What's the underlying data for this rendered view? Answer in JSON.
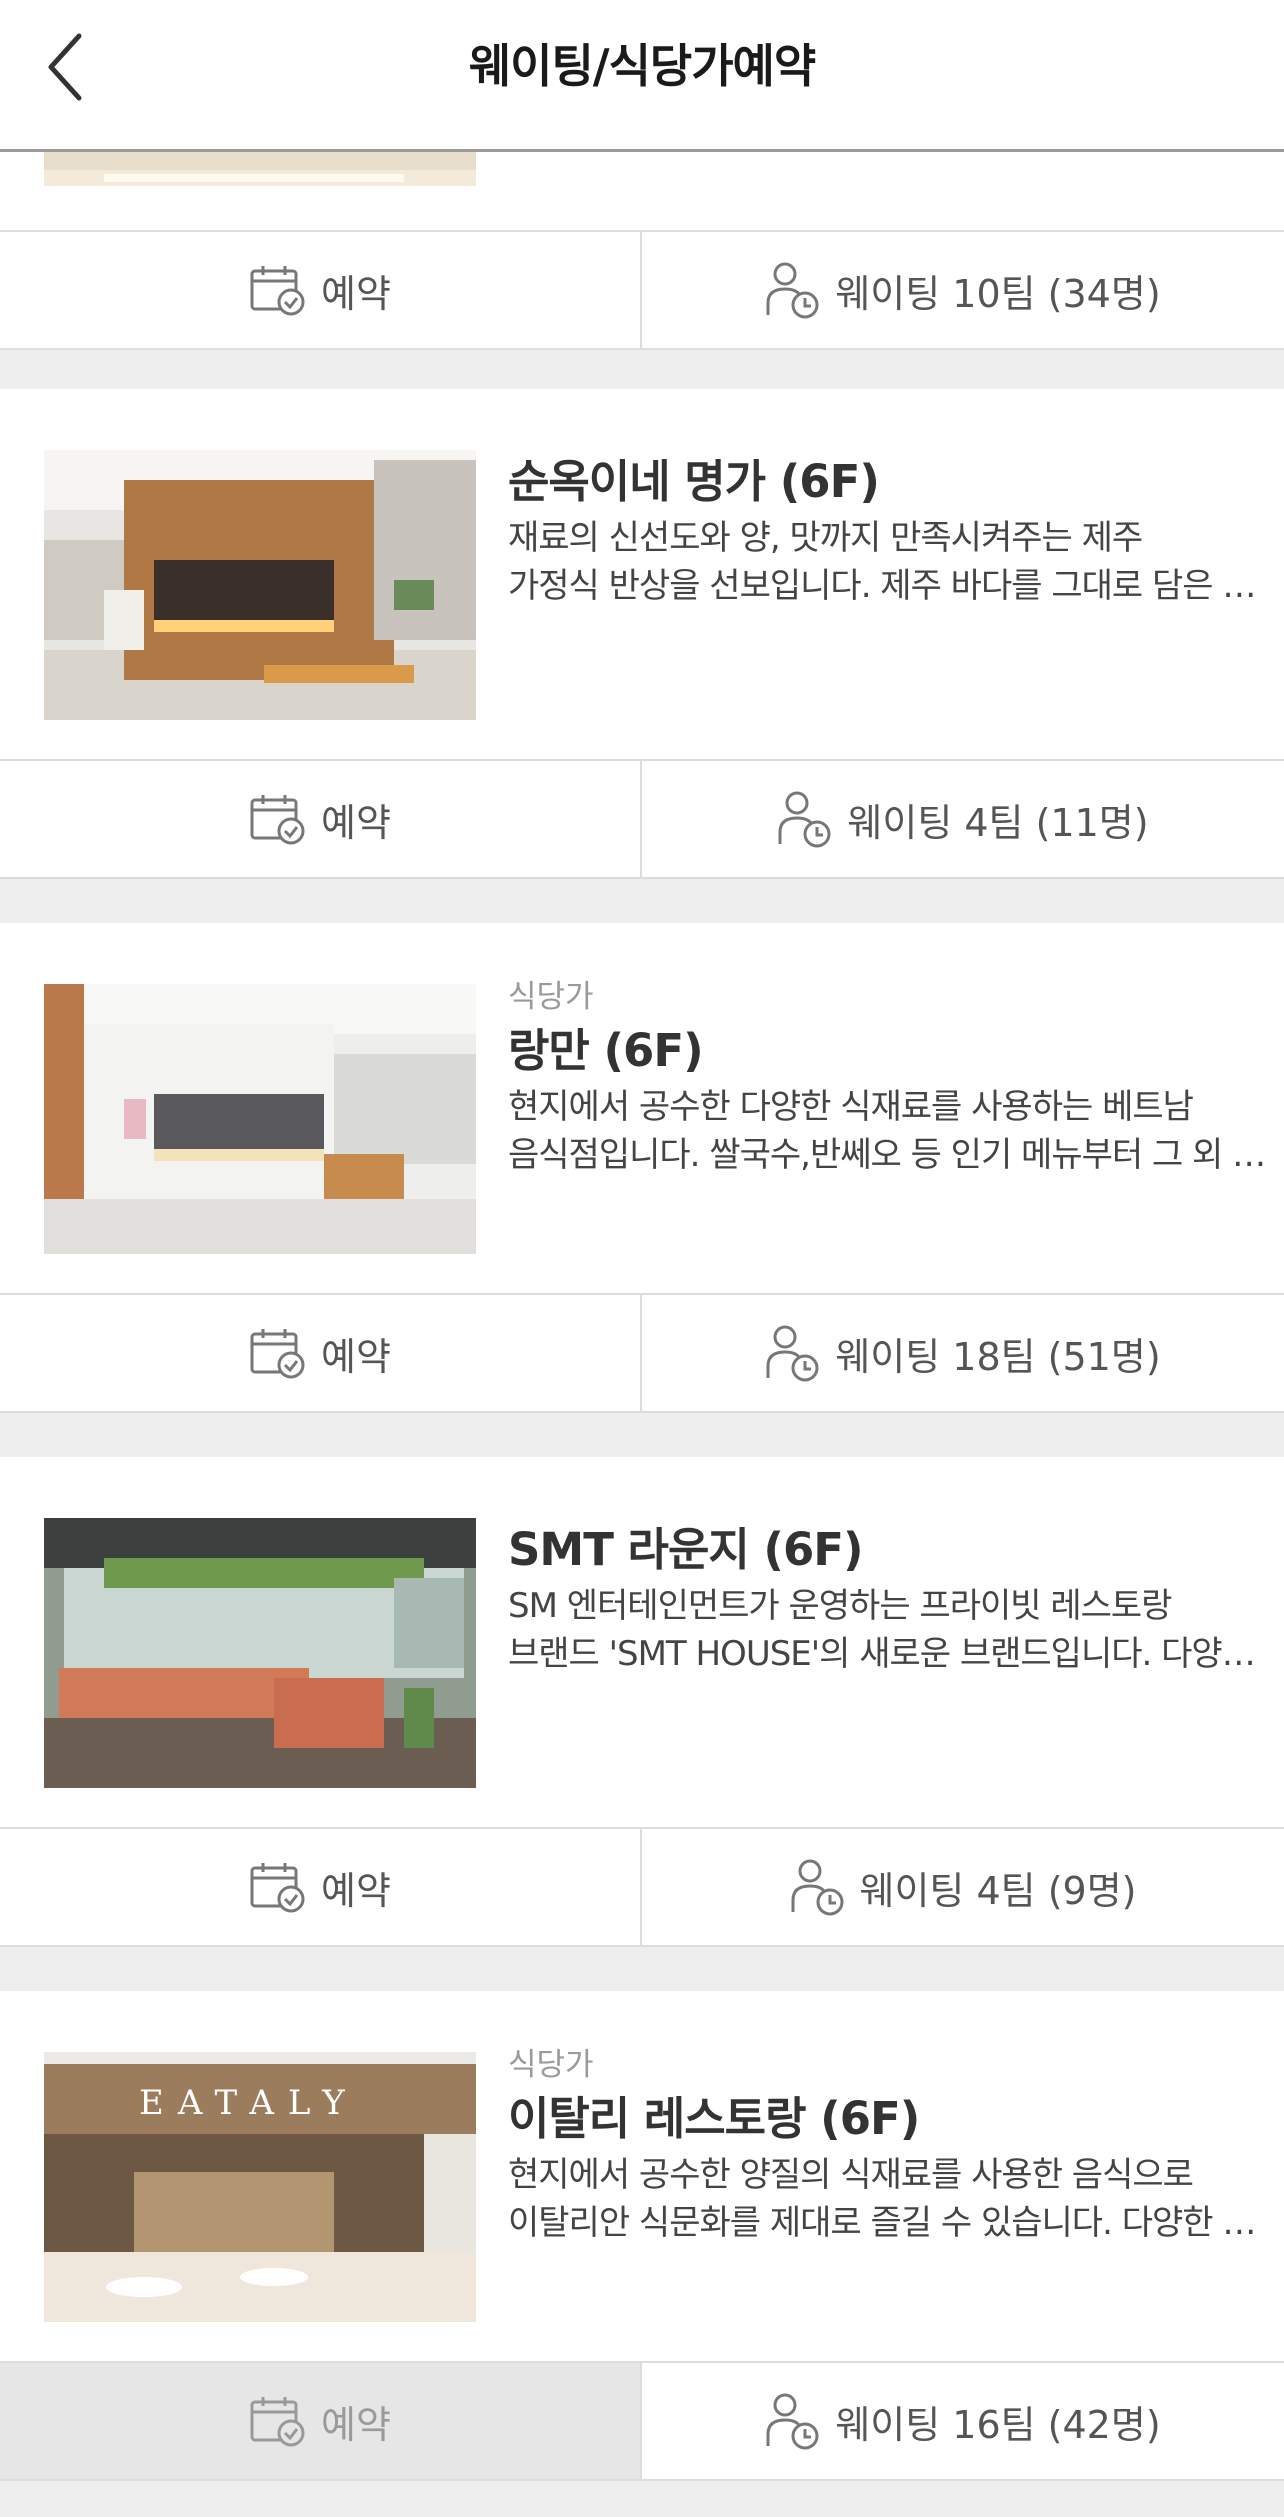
{
  "header": {
    "title": "웨이팅/식당가예약",
    "back_icon": "chevron-left-icon"
  },
  "cards": [
    {
      "category": "",
      "name": "",
      "desc": [
        "",
        ""
      ],
      "reserve_label": "예약",
      "waiting_label": "웨이팅 10팀 (34명)"
    },
    {
      "category": "",
      "name": "순옥이네 명가 (6F)",
      "desc": [
        "재료의 신선도와 양, 맛까지 만족시켜주는 제주",
        "가정식 반상을 선보입니다. 제주 바다를 그대로 담은 음식을 즐겨보세요."
      ],
      "reserve_label": "예약",
      "waiting_label": "웨이팅 4팀 (11명)"
    },
    {
      "category": "식당가",
      "name": "랑만 (6F)",
      "desc": [
        "현지에서 공수한 다양한 식재료를 사용하는 베트남",
        "음식점입니다. 쌀국수,반쎄오 등 인기 메뉴부터 그 외 다양한 메뉴가 있습니다."
      ],
      "reserve_label": "예약",
      "waiting_label": "웨이팅 18팀 (51명)"
    },
    {
      "category": "",
      "name": "SMT 라운지 (6F)",
      "desc": [
        "SM 엔터테인먼트가 운영하는 프라이빗 레스토랑",
        "브랜드 'SMT HOUSE'의 새로운 브랜드입니다. 다양한 메뉴를 즐겨보세요."
      ],
      "reserve_label": "예약",
      "waiting_label": "웨이팅 4팀 (9명)"
    },
    {
      "category": "식당가",
      "name": "이탈리 레스토랑 (6F)",
      "desc": [
        "현지에서 공수한 양질의 식재료를 사용한 음식으로",
        "이탈리안 식문화를 제대로 즐길 수 있습니다. 다양한 메뉴를 만나보세요."
      ],
      "reserve_label": "예약",
      "waiting_label": "웨이팅 16팀 (42명)",
      "image_sign": "EATALY"
    }
  ],
  "colors": {
    "background": "#eeeeee",
    "card": "#ffffff",
    "divider": "#dcdcdc",
    "pressed": "#e6e6e6"
  }
}
